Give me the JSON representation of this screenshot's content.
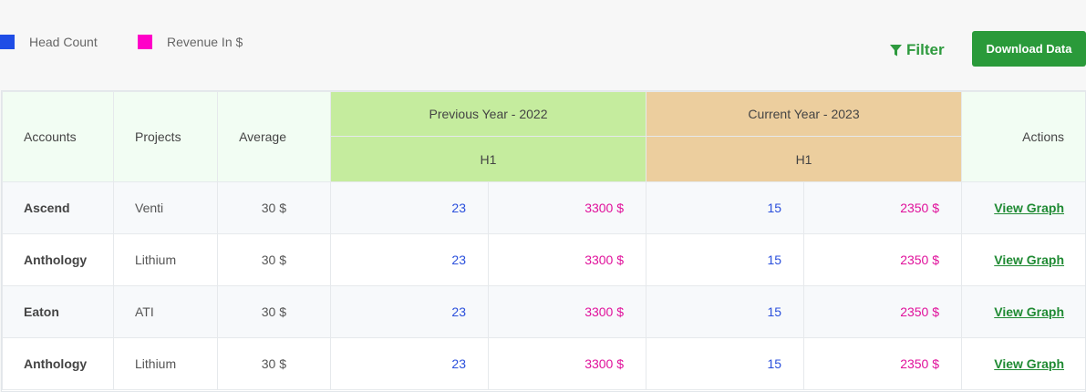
{
  "legend": [
    {
      "label": "Head Count",
      "color": "#1f4de6"
    },
    {
      "label": "Revenue In $",
      "color": "#ff00c8"
    }
  ],
  "toolbar": {
    "filter_label": "Filter",
    "download_label": "Download Data",
    "filter_icon": "funnel-icon"
  },
  "table": {
    "headers": {
      "accounts": "Accounts",
      "projects": "Projects",
      "average": "Average",
      "previous_year": "Previous Year - 2022",
      "current_year": "Current Year - 2023",
      "prev_half": "H1",
      "curr_half": "H1",
      "actions": "Actions"
    },
    "rows": [
      {
        "account": "Ascend",
        "project": "Venti",
        "average": "30 $",
        "prev_headcount": "23",
        "prev_revenue": "3300 $",
        "curr_headcount": "15",
        "curr_revenue": "2350 $",
        "action": "View Graph"
      },
      {
        "account": "Anthology",
        "project": "Lithium",
        "average": "30 $",
        "prev_headcount": "23",
        "prev_revenue": "3300 $",
        "curr_headcount": "15",
        "curr_revenue": "2350 $",
        "action": "View Graph"
      },
      {
        "account": "Eaton",
        "project": "ATI",
        "average": "30 $",
        "prev_headcount": "23",
        "prev_revenue": "3300 $",
        "curr_headcount": "15",
        "curr_revenue": "2350 $",
        "action": "View Graph"
      },
      {
        "account": "Anthology",
        "project": "Lithium",
        "average": "30 $",
        "prev_headcount": "23",
        "prev_revenue": "3300 $",
        "curr_headcount": "15",
        "curr_revenue": "2350 $",
        "action": "View Graph"
      }
    ]
  },
  "colors": {
    "headcount": "#2a4fdc",
    "revenue": "#e0119b",
    "accent": "#2a9a3a",
    "previous_year_bg": "#c5ec9e",
    "current_year_bg": "#ecce9e"
  }
}
